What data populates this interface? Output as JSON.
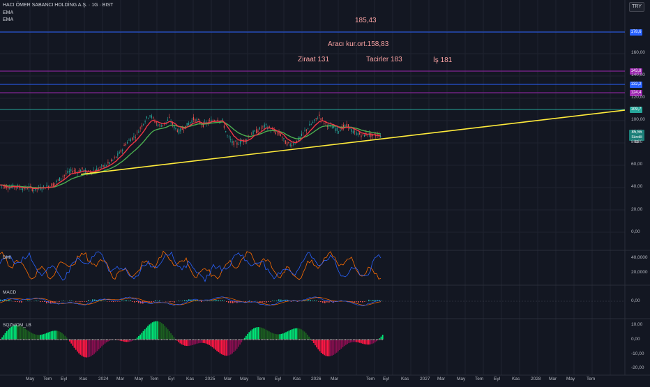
{
  "header": {
    "symbol": "HACI ÖMER SABANCI HOLDİNG A.Ş. · 1G · BIST",
    "indicators": [
      "EMA",
      "EMA"
    ],
    "currency": "TRY"
  },
  "annotations": {
    "a1": "185,43",
    "a2": "Aracı kur.ort.158,83",
    "a3": "Ziraat 131",
    "a4": "Tacirler 183",
    "a5": "İş 181"
  },
  "levels": [
    {
      "label": "178,6",
      "color": "#2962ff"
    },
    {
      "label": "143,8",
      "color": "#9c27b0"
    },
    {
      "label": "132,2",
      "color": "#2962ff"
    },
    {
      "label": "124,4",
      "color": "#9c27b0"
    },
    {
      "label": "109,7",
      "color": "#26a69a"
    }
  ],
  "last_price": {
    "value": "85,55",
    "sub": "Sürekli 60"
  },
  "price_axis": [
    "160,00",
    "140,00",
    "120,00",
    "100,00",
    "80,00",
    "60,00",
    "40,00",
    "20,00",
    "0,00"
  ],
  "panels": {
    "dmi": {
      "name": "DMI",
      "ticks": [
        "40,0000",
        "20,0000"
      ]
    },
    "macd": {
      "name": "MACD",
      "ticks": [
        "0,00"
      ]
    },
    "sqz": {
      "name": "SQZMOM_LB",
      "ticks": [
        "10,00",
        "0,00",
        "-10,00",
        "-20,00"
      ]
    }
  },
  "time_axis": [
    "May",
    "Tem",
    "Eyl",
    "Kas",
    "2024",
    "Mar",
    "May",
    "Tem",
    "Eyl",
    "Kas",
    "2025",
    "Mar",
    "May",
    "Tem",
    "Eyl",
    "Kas",
    "2026",
    "Mar",
    "Tem",
    "Eyl",
    "Kas",
    "2027",
    "Mar",
    "May",
    "Tem",
    "Eyl",
    "Kas",
    "2028",
    "Mar",
    "May",
    "Tem"
  ],
  "colors": {
    "bg": "#131722",
    "grid": "#1f2330",
    "candle_up": "#26a69a",
    "candle_down": "#ef5350",
    "ema_fast": "#f23645",
    "ema_slow": "#4caf50",
    "trend": "#ffeb3b",
    "dmi_plus": "#2962ff",
    "dmi_minus": "#ff6d00",
    "macd_line": "#2962ff",
    "signal_line": "#ff6d00",
    "sqz_up_strong": "#00e676",
    "sqz_up_weak": "#1b5e20",
    "sqz_dn_strong": "#ff1744",
    "sqz_dn_weak": "#880e4f"
  },
  "price_series": [
    42,
    41,
    40,
    41,
    40,
    39,
    40,
    38,
    39,
    40,
    41,
    43,
    46,
    50,
    53,
    55,
    54,
    56,
    53,
    55,
    56,
    58,
    60,
    63,
    67,
    72,
    79,
    83,
    86,
    93,
    100,
    105,
    99,
    95,
    97,
    101,
    94,
    90,
    93,
    97,
    101,
    99,
    96,
    98,
    100,
    101,
    99,
    86,
    80,
    79,
    81,
    83,
    88,
    90,
    93,
    95,
    92,
    89,
    87,
    80,
    78,
    80,
    84,
    90,
    95,
    99,
    104,
    98,
    95,
    93,
    91,
    94,
    95,
    89,
    88,
    86,
    88,
    86,
    87,
    86
  ]
}
